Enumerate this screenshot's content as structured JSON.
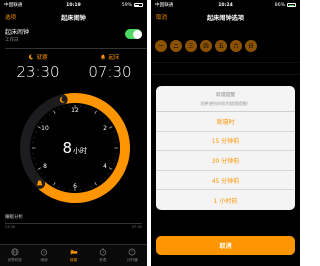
{
  "left": {
    "status": {
      "carrier": "中国联通",
      "time": "10:19",
      "battery": "59%"
    },
    "nav": {
      "left": "选项",
      "title": "起床闹钟"
    },
    "alarm_row": {
      "label": "起床闹钟",
      "sub": "工作日",
      "enabled": true
    },
    "bedtime": {
      "label": "就寝",
      "time": "23:30"
    },
    "wake": {
      "label": "起床",
      "time": "07:30"
    },
    "clock": {
      "duration_value": "8",
      "duration_unit": "小时",
      "numbers": [
        "12",
        "2",
        "4",
        "6",
        "8",
        "10"
      ]
    },
    "analysis": {
      "label": "睡眠分析",
      "ticks": [
        "23:30",
        "07:30"
      ]
    },
    "tabs": [
      {
        "label": "世界时钟",
        "icon": "globe-icon"
      },
      {
        "label": "闹钟",
        "icon": "alarm-clock-icon"
      },
      {
        "label": "就寝",
        "icon": "bed-icon",
        "active": true
      },
      {
        "label": "秒表",
        "icon": "stopwatch-icon"
      },
      {
        "label": "计时器",
        "icon": "timer-icon"
      }
    ]
  },
  "right": {
    "status": {
      "carrier": "中国联通",
      "time": "10:24",
      "battery": "86%"
    },
    "nav": {
      "left": "取消",
      "title": "起床闹钟选项"
    },
    "days": [
      "一",
      "二",
      "三",
      "四",
      "五",
      "六",
      "日"
    ],
    "sheet": {
      "title": "就寝提醒",
      "desc": "您希望何时收到就寝提醒？",
      "options": [
        "就寝时",
        "15 分钟前",
        "30 分钟前",
        "45 分钟前",
        "1 小时前"
      ],
      "cancel": "取消"
    }
  },
  "colors": {
    "accent": "#ff9500",
    "toggle_on": "#4cd964",
    "background": "#000000",
    "sheet": "#f4f4f4"
  }
}
